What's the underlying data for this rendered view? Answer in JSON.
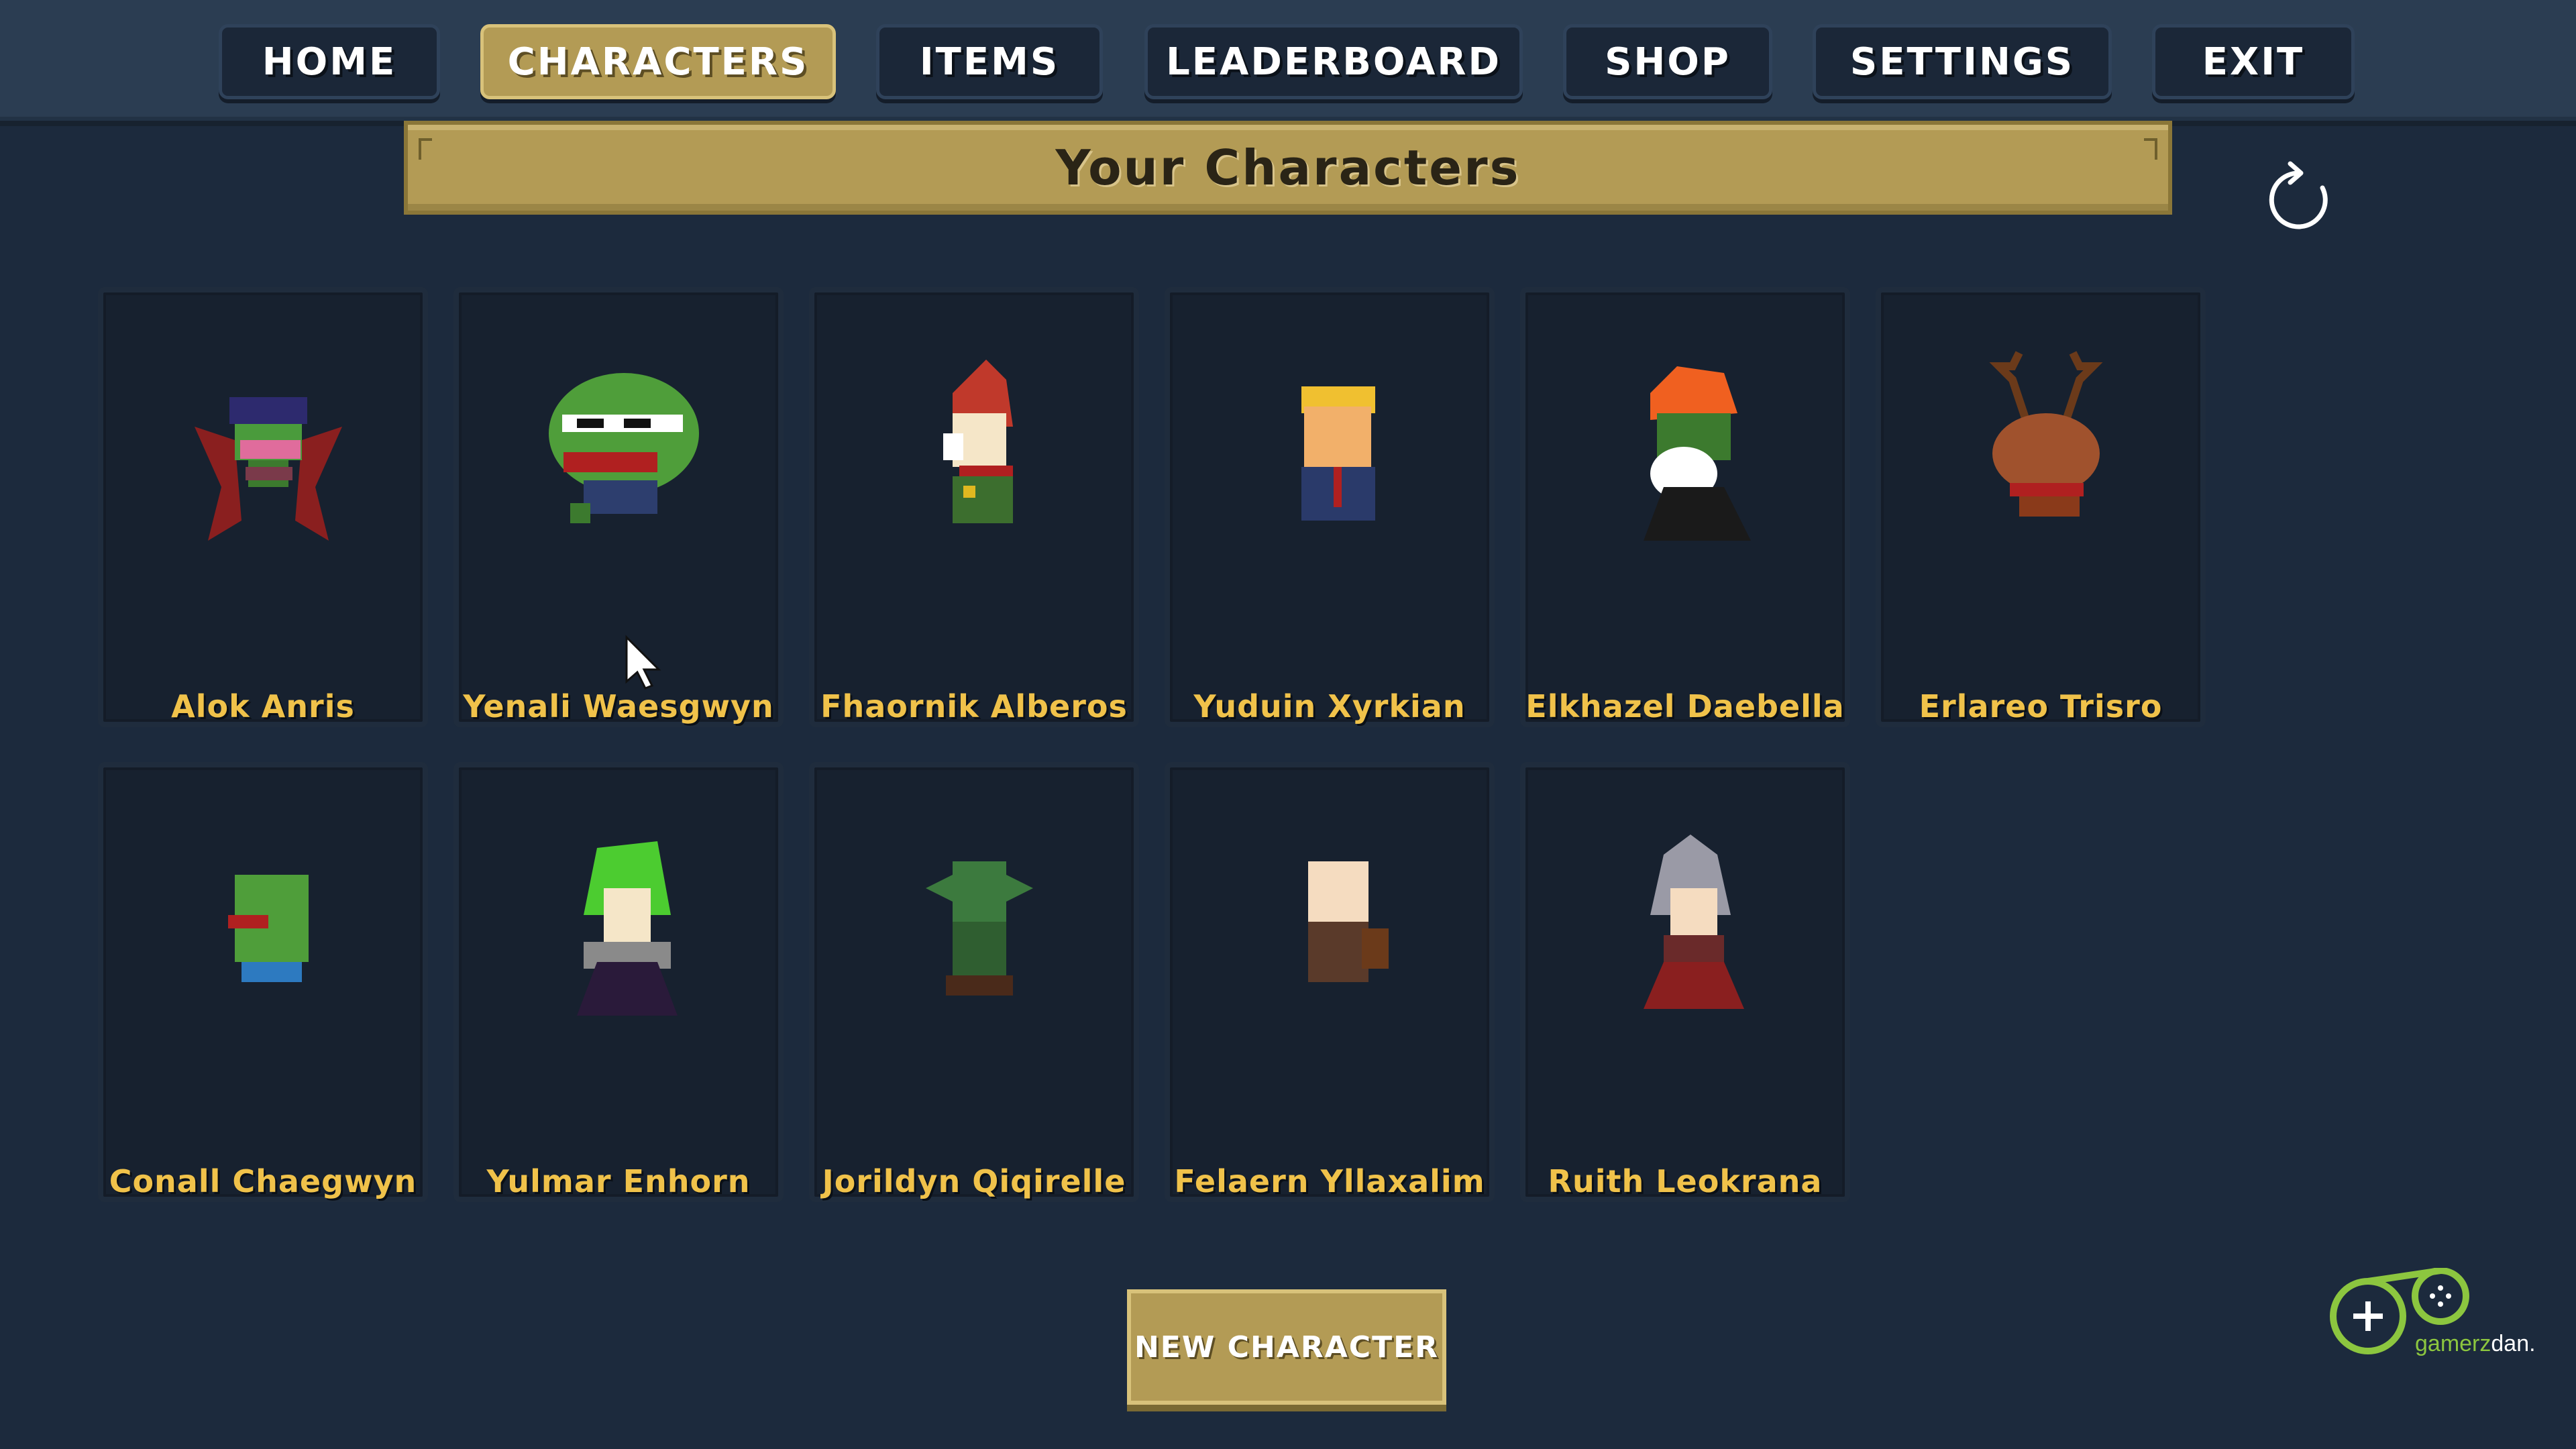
{
  "nav": {
    "items": [
      {
        "label": "HOME",
        "active": false
      },
      {
        "label": "CHARACTERS",
        "active": true
      },
      {
        "label": "ITEMS",
        "active": false
      },
      {
        "label": "LEADERBOARD",
        "active": false
      },
      {
        "label": "SHOP",
        "active": false
      },
      {
        "label": "SETTINGS",
        "active": false
      },
      {
        "label": "EXIT",
        "active": false
      }
    ]
  },
  "banner": {
    "title": "Your Characters"
  },
  "refresh": {
    "icon": "refresh-icon"
  },
  "characters": [
    {
      "name": "Alok Anris",
      "sprite": "frog-vampire-caped"
    },
    {
      "name": "Yenali Waesgwyn",
      "sprite": "frog-with-sunglasses"
    },
    {
      "name": "Fhaornik Alberos",
      "sprite": "gnome-red-hair"
    },
    {
      "name": "Yuduin Xyrkian",
      "sprite": "blond-suit-man"
    },
    {
      "name": "Elkhazel Daebella",
      "sprite": "orange-haired-bearded-orc"
    },
    {
      "name": "Erlareo Trisro",
      "sprite": "antlered-deer"
    },
    {
      "name": "Conall Chaegwyn",
      "sprite": "green-frog-small"
    },
    {
      "name": "Yulmar Enhorn",
      "sprite": "green-haired-mage"
    },
    {
      "name": "Jorildyn Qiqirelle",
      "sprite": "green-goblin"
    },
    {
      "name": "Felaern Yllaxalim",
      "sprite": "bald-warrior"
    },
    {
      "name": "Ruith Leokrana",
      "sprite": "silver-helmet-warrior"
    }
  ],
  "new_character": {
    "label": "NEW CHARACTER"
  },
  "logo": {
    "brand": "gamerz",
    "suffix": "dan."
  },
  "colors": {
    "background": "#1c2a3d",
    "gold": "#b39b55",
    "name_text": "#f0c24a",
    "logo_green": "#8cc63f"
  }
}
